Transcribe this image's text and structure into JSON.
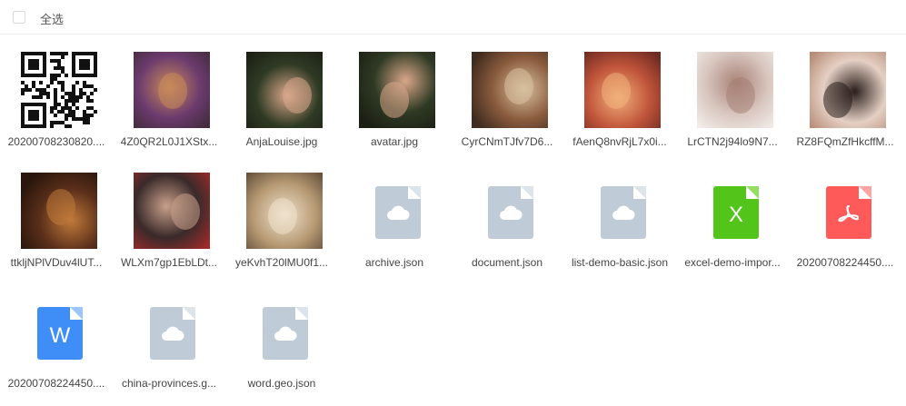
{
  "toolbar": {
    "select_all": "全选"
  },
  "files": [
    {
      "name": "20200708230820....",
      "kind": "qr"
    },
    {
      "name": "4Z0QR2L0J1XStx...",
      "kind": "photo",
      "palette": [
        "#6b3a6e",
        "#c98a5a",
        "#3d2a35"
      ]
    },
    {
      "name": "AnjaLouise.jpg",
      "kind": "photo",
      "palette": [
        "#2f3a24",
        "#d9a78a",
        "#1b1f14"
      ]
    },
    {
      "name": "avatar.jpg",
      "kind": "photo",
      "palette": [
        "#2f3a24",
        "#d9a78a",
        "#1b1f14"
      ]
    },
    {
      "name": "CyrCNmTJfv7D6...",
      "kind": "photo",
      "palette": [
        "#8a5b3d",
        "#d8c1a0",
        "#3f2b1f"
      ]
    },
    {
      "name": "fAenQ8nvRjL7x0i...",
      "kind": "photo",
      "palette": [
        "#c0543a",
        "#f0b07a",
        "#6d2a22"
      ]
    },
    {
      "name": "LrCTN2j94lo9N7...",
      "kind": "photo",
      "palette": [
        "#d8c6bf",
        "#a88276",
        "#f3ece8"
      ]
    },
    {
      "name": "RZ8FQmZfHkcffM...",
      "kind": "photo",
      "palette": [
        "#e5d0c4",
        "#2a1e1b",
        "#b58a74"
      ]
    },
    {
      "name": "ttkljNPlVDuv4lUT...",
      "kind": "photo",
      "palette": [
        "#5b2f1a",
        "#c07a3a",
        "#2a160c"
      ]
    },
    {
      "name": "WLXm7gp1EbLDt...",
      "kind": "photo",
      "palette": [
        "#3a2a2a",
        "#c9a08a",
        "#a02a2a"
      ]
    },
    {
      "name": "yeKvhT20lMU0f1...",
      "kind": "photo",
      "palette": [
        "#b79a74",
        "#efe2cc",
        "#5e4a36"
      ]
    },
    {
      "name": "archive.json",
      "kind": "generic"
    },
    {
      "name": "document.json",
      "kind": "generic"
    },
    {
      "name": "list-demo-basic.json",
      "kind": "generic"
    },
    {
      "name": "excel-demo-impor...",
      "kind": "excel",
      "glyph": "X"
    },
    {
      "name": "20200708224450....",
      "kind": "pdf"
    },
    {
      "name": "20200708224450....",
      "kind": "word",
      "glyph": "W"
    },
    {
      "name": "china-provinces.g...",
      "kind": "generic"
    },
    {
      "name": "word.geo.json",
      "kind": "generic"
    }
  ],
  "colors": {
    "generic_icon": "#bfccd8",
    "generic_fold": "#dde5ec",
    "excel_icon": "#52c41a",
    "excel_fold": "#95de64",
    "pdf_icon": "#ff5a5a",
    "pdf_fold": "#ffa3a3",
    "word_icon": "#3f8ef7",
    "word_fold": "#9cc4ff"
  }
}
